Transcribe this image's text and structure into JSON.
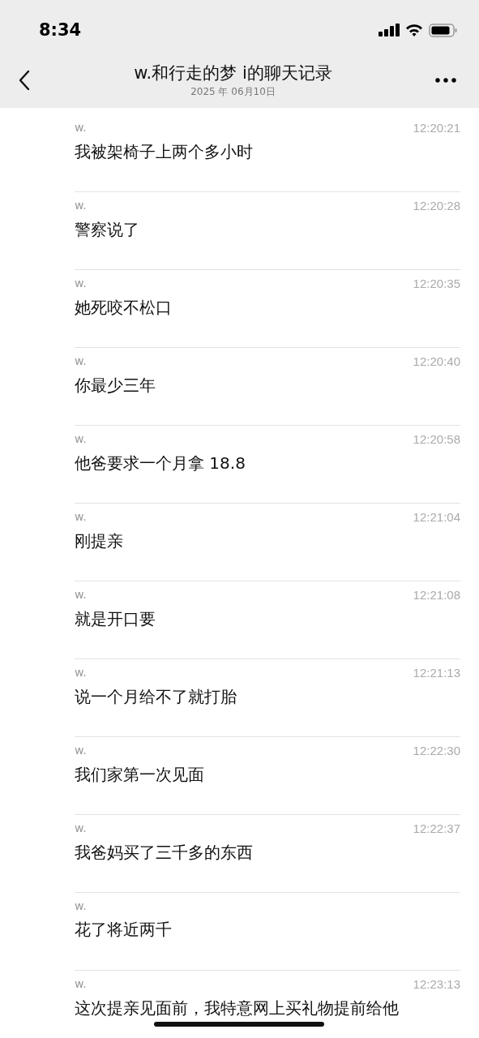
{
  "status_bar": {
    "time": "8:34"
  },
  "header": {
    "title": "w.和行走的梦 i的聊天记录",
    "subtitle": "2025 年 06月10日"
  },
  "messages": [
    {
      "sender": "w.",
      "time": "12:20:21",
      "text": "我被架椅子上两个多小时"
    },
    {
      "sender": "w.",
      "time": "12:20:28",
      "text": "警察说了"
    },
    {
      "sender": "w.",
      "time": "12:20:35",
      "text": "她死咬不松口"
    },
    {
      "sender": "w.",
      "time": "12:20:40",
      "text": "你最少三年"
    },
    {
      "sender": "w.",
      "time": "12:20:58",
      "text": "他爸要求一个月拿 18.8"
    },
    {
      "sender": "w.",
      "time": "12:21:04",
      "text": "刚提亲"
    },
    {
      "sender": "w.",
      "time": "12:21:08",
      "text": "就是开口要"
    },
    {
      "sender": "w.",
      "time": "12:21:13",
      "text": "说一个月给不了就打胎"
    },
    {
      "sender": "w.",
      "time": "12:22:30",
      "text": "我们家第一次见面"
    },
    {
      "sender": "w.",
      "time": "12:22:37",
      "text": "我爸妈买了三千多的东西"
    },
    {
      "sender": "w.",
      "text": "花了将近两千"
    },
    {
      "sender": "w.",
      "time": "12:23:13",
      "text": "这次提亲见面前，我特意网上买礼物提前给他"
    }
  ]
}
